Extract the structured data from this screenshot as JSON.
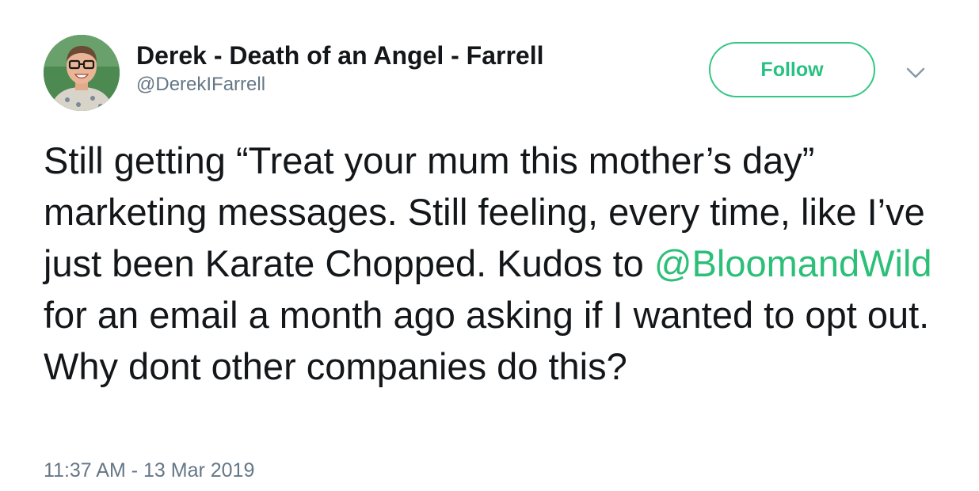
{
  "user": {
    "display_name": "Derek - Death of an Angel - Farrell",
    "handle": "@DerekIFarrell"
  },
  "follow_button": {
    "label": "Follow"
  },
  "icons": {
    "menu": "chevron-down-icon"
  },
  "tweet": {
    "text_before_mention": "Still getting “Treat your mum this mother’s day” marketing messages. Still feeling, every time, like I’ve just been Karate Chopped. Kudos to ",
    "mention": "@BloomandWild",
    "text_after_mention": " for an email a month ago asking if I wanted to opt out. Why dont other companies do this?",
    "timestamp": "11:37 AM - 13 Mar 2019"
  },
  "colors": {
    "accent": "#26c281",
    "text": "#14171a",
    "secondary": "#657786"
  }
}
